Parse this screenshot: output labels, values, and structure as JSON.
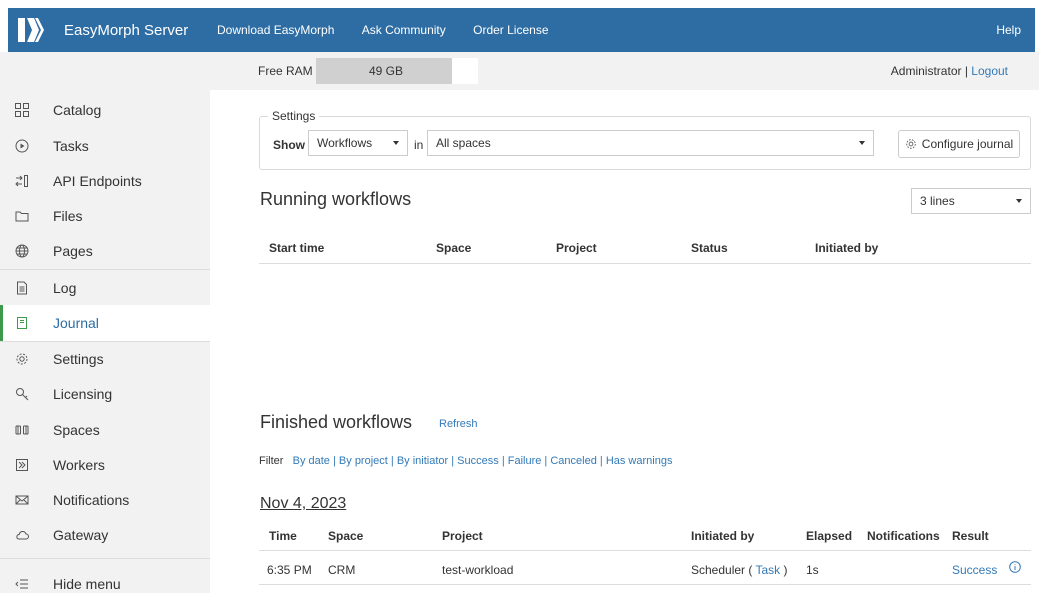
{
  "header": {
    "brand": "EasyMorph Server",
    "nav": [
      "Download EasyMorph",
      "Ask Community",
      "Order License"
    ],
    "help": "Help",
    "colors": {
      "topbar": "#2e6da4",
      "link": "#337ab7",
      "active_accent": "#3c9a4a"
    }
  },
  "status": {
    "free_ram_label": "Free RAM",
    "free_ram_value": "49 GB",
    "user": "Administrator",
    "separator": "|",
    "logout": "Logout"
  },
  "sidebar": {
    "items": [
      {
        "label": "Catalog",
        "icon": "grid-icon"
      },
      {
        "label": "Tasks",
        "icon": "play-circle-icon"
      },
      {
        "label": "API Endpoints",
        "icon": "api-icon"
      },
      {
        "label": "Files",
        "icon": "folder-icon"
      },
      {
        "label": "Pages",
        "icon": "globe-icon"
      },
      {
        "label": "Log",
        "icon": "document-icon"
      },
      {
        "label": "Journal",
        "icon": "journal-icon",
        "active": true
      },
      {
        "label": "Settings",
        "icon": "gear-icon"
      },
      {
        "label": "Licensing",
        "icon": "key-icon"
      },
      {
        "label": "Spaces",
        "icon": "spaces-icon"
      },
      {
        "label": "Workers",
        "icon": "workers-icon"
      },
      {
        "label": "Notifications",
        "icon": "envelope-icon"
      },
      {
        "label": "Gateway",
        "icon": "cloud-icon"
      }
    ],
    "hide_menu": "Hide menu"
  },
  "settings": {
    "legend": "Settings",
    "show_label": "Show",
    "show_value": "Workflows",
    "in_label": "in",
    "space_value": "All spaces",
    "configure_button": "Configure journal"
  },
  "running": {
    "title": "Running workflows",
    "lines_value": "3 lines",
    "columns": [
      "Start time",
      "Space",
      "Project",
      "Status",
      "Initiated by"
    ]
  },
  "finished": {
    "title": "Finished workflows",
    "refresh": "Refresh",
    "filter_label": "Filter",
    "filters": [
      "By date",
      "By project",
      "By initiator",
      "Success",
      "Failure",
      "Canceled",
      "Has warnings"
    ],
    "date": "Nov 4, 2023",
    "columns": [
      "Time",
      "Space",
      "Project",
      "Initiated by",
      "Elapsed",
      "Notifications",
      "Result"
    ],
    "rows": [
      {
        "time": "6:35 PM",
        "space": "CRM",
        "project": "test-workload",
        "initiator": "Scheduler",
        "initiator_link": "Task",
        "elapsed": "1s",
        "notifications": "",
        "result": "Success"
      }
    ]
  }
}
